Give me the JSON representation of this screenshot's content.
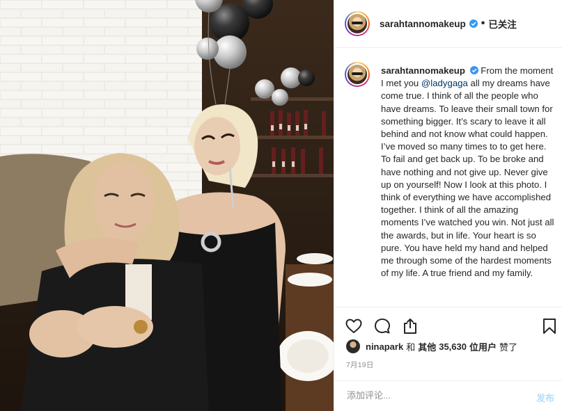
{
  "post": {
    "username": "sarahtannomakeup",
    "header_separator": "•",
    "follow_status": "已关注",
    "caption": {
      "username": "sarahtannomakeup",
      "text_before_mention": "From the moment I met you ",
      "mention": "@ladygaga",
      "text_after_mention": " all my dreams have come true. I think of all the people who have dreams. To leave their small town for something bigger. It’s scary to leave it all behind and not know what could happen. I’ve moved so many times to to get here. To fail and get back up. To be broke and have nothing and not give up. Never give up on yourself! Now I look at this photo. I think of everything we have accomplished together. I think of all the amazing moments I’ve watched you win. Not just all the awards, but in life. Your heart is so pure. You have held my hand and helped me through some of the hardest moments of my life. A true friend and my family."
    },
    "likes": {
      "liker": "ninapark",
      "connector": "和",
      "others_prefix": "其他",
      "count": "35,630",
      "others_suffix": "位用户",
      "action": "赞了"
    },
    "date": "7月19日",
    "comment": {
      "placeholder": "添加评论...",
      "post_label": "发布"
    }
  },
  "icons": {
    "verified": "verified-badge-icon",
    "like": "heart-icon",
    "comment": "comment-bubble-icon",
    "share": "share-icon",
    "save": "bookmark-icon"
  },
  "colors": {
    "verified": "#3897f0",
    "mention": "#003569",
    "post_disabled": "#b2dffc",
    "muted": "#8e8e8e"
  }
}
